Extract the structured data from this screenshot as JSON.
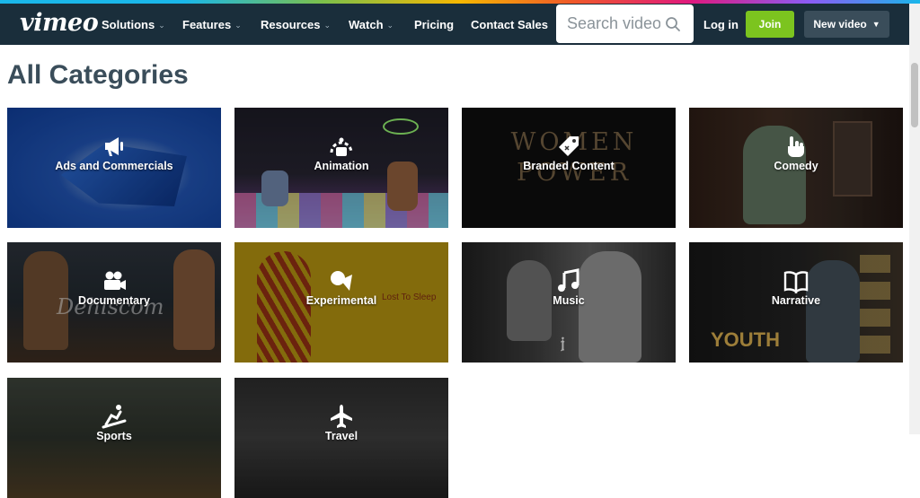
{
  "header": {
    "logo": "vimeo",
    "nav": [
      {
        "label": "Solutions",
        "has_dropdown": true
      },
      {
        "label": "Features",
        "has_dropdown": true
      },
      {
        "label": "Resources",
        "has_dropdown": true
      },
      {
        "label": "Watch",
        "has_dropdown": true
      },
      {
        "label": "Pricing",
        "has_dropdown": false
      },
      {
        "label": "Contact Sales",
        "has_dropdown": false
      }
    ],
    "search": {
      "placeholder": "Search videos",
      "value": ""
    },
    "login_label": "Log in",
    "join_label": "Join",
    "new_video_label": "New video",
    "colors": {
      "header_bg": "#1a2e3b",
      "join_green": "#7cc41f",
      "new_video_bg": "#3a4d5a"
    }
  },
  "page": {
    "title": "All Categories"
  },
  "categories": [
    {
      "label": "Ads and Commercials",
      "icon": "megaphone-icon",
      "overlay_text": ""
    },
    {
      "label": "Animation",
      "icon": "animation-icon",
      "overlay_text": ""
    },
    {
      "label": "Branded Content",
      "icon": "tag-icon",
      "overlay_text": "WOMEN POWER"
    },
    {
      "label": "Comedy",
      "icon": "comedy-hand-icon",
      "overlay_text": ""
    },
    {
      "label": "Documentary",
      "icon": "camera-icon",
      "overlay_text": "Dehiscom"
    },
    {
      "label": "Experimental",
      "icon": "experimental-icon",
      "overlay_text": "Lost To Sleep"
    },
    {
      "label": "Music",
      "icon": "music-note-icon",
      "overlay_text": ""
    },
    {
      "label": "Narrative",
      "icon": "book-icon",
      "overlay_text": "YOUTH"
    },
    {
      "label": "Sports",
      "icon": "sports-icon",
      "overlay_text": ""
    },
    {
      "label": "Travel",
      "icon": "airplane-icon",
      "overlay_text": ""
    }
  ]
}
